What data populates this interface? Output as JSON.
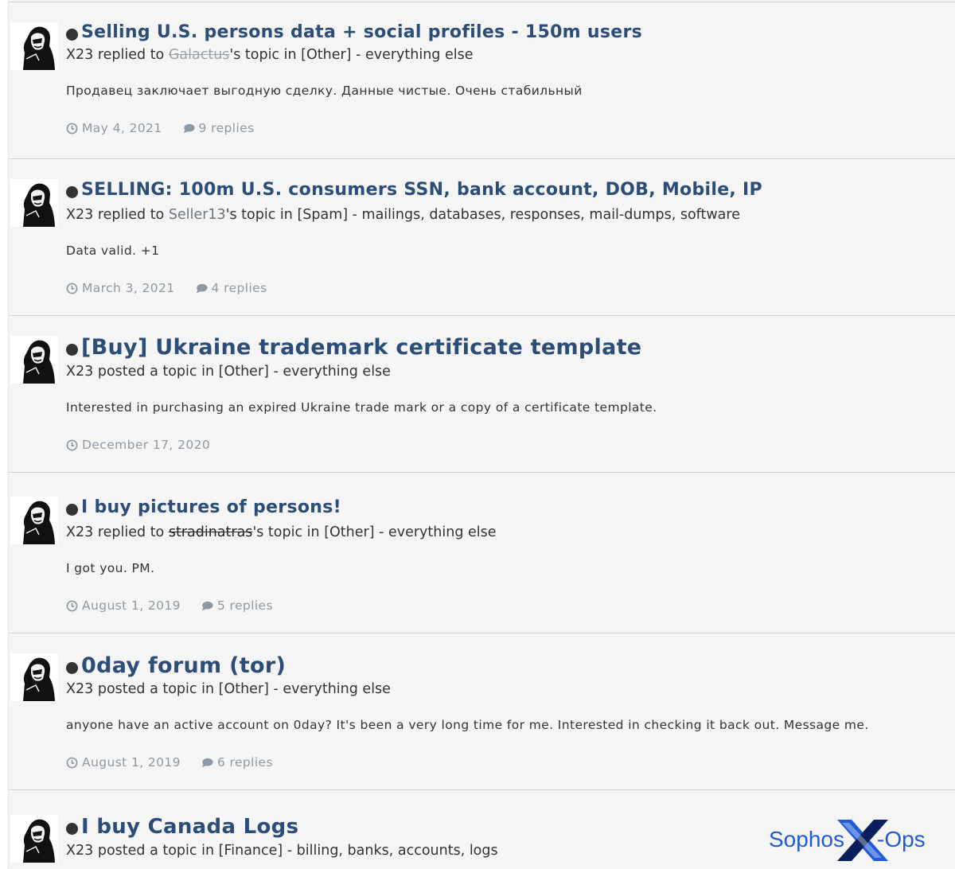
{
  "posts": [
    {
      "title": "Selling U.S. persons data + social profiles - 150m users",
      "author": "X23",
      "action": "replied to",
      "target_user": "Galactus",
      "target_suffix": "'s topic in",
      "forum": "[Other] - everything else",
      "snippet": "Продавец заключает выгодную сделку. Данные чистые. Очень стабильный",
      "date": "May 4, 2021",
      "replies": "9 replies"
    },
    {
      "title": "SELLING: 100m U.S. consumers SSN, bank account, DOB, Mobile, IP",
      "author": "X23",
      "action": "replied to",
      "target_user": "Seller13",
      "target_suffix": "'s topic in",
      "forum": "[Spam] - mailings, databases, responses, mail-dumps, software",
      "snippet": "Data valid. +1",
      "date": "March 3, 2021",
      "replies": "4 replies"
    },
    {
      "title": "[Buy] Ukraine trademark certificate template",
      "author": "X23",
      "action": "posted a topic in",
      "forum": "[Other] - everything else",
      "snippet": "Interested in purchasing an expired Ukraine trade mark or a copy of a certificate template.",
      "date": "December 17, 2020"
    },
    {
      "title": "I buy pictures of persons!",
      "author": "X23",
      "action": "replied to",
      "target_user": "stradinatras",
      "target_suffix": "'s topic in",
      "forum": "[Other] - everything else",
      "snippet": "I got you. PM.",
      "date": "August 1, 2019",
      "replies": "5 replies"
    },
    {
      "title": "0day forum (tor)",
      "author": "X23",
      "action": "posted a topic in",
      "forum": "[Other] - everything else",
      "snippet": "anyone have an active account on 0day? It's been a very long time for me. Interested in checking it back out. Message me.",
      "date": "August 1, 2019",
      "replies": "6 replies"
    },
    {
      "title": "I buy Canada Logs",
      "author": "X23",
      "action": "posted a topic in",
      "forum": "[Finance] - billing, banks, accounts, logs"
    }
  ],
  "watermark": {
    "brand": "Sophos",
    "product": "-Ops",
    "colors": {
      "blue": "#1f5bd6",
      "navy": "#0a1f5c"
    }
  },
  "icons": {
    "clock": "clock-icon",
    "replies": "speech-bubble-icon",
    "unread": "unread-dot-icon"
  }
}
